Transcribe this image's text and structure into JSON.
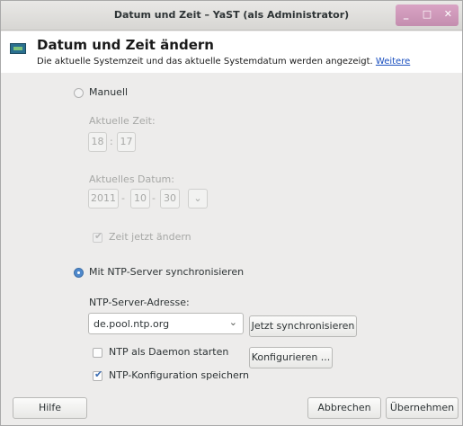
{
  "window": {
    "title": "Datum und Zeit – YaST (als Administrator)",
    "controls": [
      "_",
      "□",
      "✕"
    ]
  },
  "header": {
    "title": "Datum und Zeit ändern",
    "description": "Die aktuelle Systemzeit und das aktuelle Systemdatum werden angezeigt.",
    "more_link": "Weitere",
    "icon": "clock-calendar-icon"
  },
  "manual": {
    "label": "Manuell",
    "selected": false,
    "time_label": "Aktuelle Zeit:",
    "hour": "18",
    "minute": "17",
    "time_sep": ":",
    "date_label": "Aktuelles Datum:",
    "year": "2011",
    "month": "10",
    "day": "30",
    "date_sep": "-",
    "calendar_dropdown": "⌄",
    "change_now_label": "Zeit jetzt ändern",
    "change_now_checked": true
  },
  "ntp": {
    "label": "Mit NTP-Server synchronisieren",
    "selected": true,
    "server_label": "NTP-Server-Adresse:",
    "server_value": "de.pool.ntp.org",
    "sync_now_button": "Jetzt synchronisieren",
    "daemon_label": "NTP als Daemon starten",
    "daemon_checked": false,
    "configure_button": "Konfigurieren ...",
    "save_config_label": "NTP-Konfiguration speichern",
    "save_config_checked": true
  },
  "footer": {
    "help": "Hilfe",
    "cancel": "Abbrechen",
    "accept": "Übernehmen"
  },
  "colors": {
    "accent": "#4f89cc",
    "link": "#1a4fbf",
    "titlebar_buttons": "#c48eaf"
  }
}
